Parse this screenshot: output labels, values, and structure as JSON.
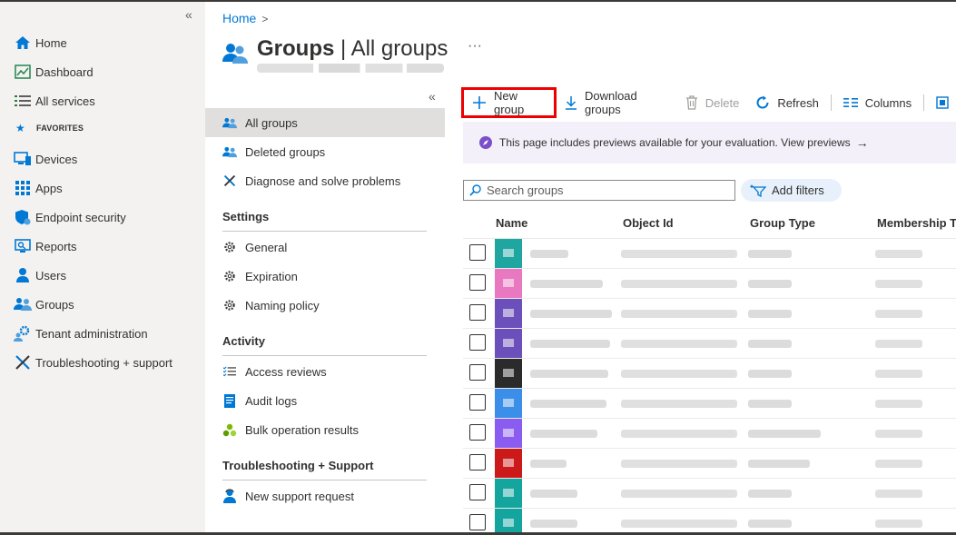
{
  "nav": {
    "items": [
      {
        "label": "Home",
        "icon": "home-icon"
      },
      {
        "label": "Dashboard",
        "icon": "dashboard-icon"
      },
      {
        "label": "All services",
        "icon": "list-icon"
      }
    ],
    "favorites_label": "FAVORITES",
    "favorites": [
      {
        "label": "Devices",
        "icon": "devices-icon"
      },
      {
        "label": "Apps",
        "icon": "apps-icon"
      },
      {
        "label": "Endpoint security",
        "icon": "shield-icon"
      },
      {
        "label": "Reports",
        "icon": "reports-icon"
      },
      {
        "label": "Users",
        "icon": "user-icon"
      },
      {
        "label": "Groups",
        "icon": "groups-icon"
      },
      {
        "label": "Tenant administration",
        "icon": "gear-people-icon"
      },
      {
        "label": "Troubleshooting + support",
        "icon": "wrench-icon"
      }
    ]
  },
  "breadcrumb": {
    "home": "Home",
    "separator": ">"
  },
  "header": {
    "title_main": "Groups",
    "title_sep": " | ",
    "title_sub": "All groups",
    "more": "···"
  },
  "menu": {
    "items": [
      {
        "label": "All groups",
        "icon": "groups-icon",
        "active": true
      },
      {
        "label": "Deleted groups",
        "icon": "groups-icon"
      },
      {
        "label": "Diagnose and solve problems",
        "icon": "wrench-icon"
      }
    ],
    "settings_title": "Settings",
    "settings": [
      {
        "label": "General",
        "icon": "gear-icon"
      },
      {
        "label": "Expiration",
        "icon": "gear-icon"
      },
      {
        "label": "Naming policy",
        "icon": "gear-icon"
      }
    ],
    "activity_title": "Activity",
    "activity": [
      {
        "label": "Access reviews",
        "icon": "checklist-icon"
      },
      {
        "label": "Audit logs",
        "icon": "log-icon"
      },
      {
        "label": "Bulk operation results",
        "icon": "bulk-icon"
      }
    ],
    "support_title": "Troubleshooting + Support",
    "support": [
      {
        "label": "New support request",
        "icon": "support-person-icon"
      }
    ]
  },
  "toolbar": {
    "new_group": "New group",
    "download_groups": "Download groups",
    "delete": "Delete",
    "refresh": "Refresh",
    "columns": "Columns"
  },
  "banner": {
    "text": "This page includes previews available for your evaluation. View previews",
    "arrow": "→"
  },
  "search": {
    "placeholder": "Search groups"
  },
  "filters": {
    "label": "Add filters"
  },
  "table": {
    "columns": [
      "Name",
      "Object Id",
      "Group Type",
      "Membership Ty"
    ],
    "row_avatar_colors": [
      "#1fa6a0",
      "#e879c0",
      "#6b4fbb",
      "#6b4fbb",
      "#2b2b2b",
      "#3b8fe8",
      "#8a5cf0",
      "#cc1a1a",
      "#15a59f",
      "#15a59f"
    ]
  },
  "colors": {
    "accent": "#0078d4",
    "highlight": "#ee0000",
    "nav_bg": "#f3f2f1"
  }
}
